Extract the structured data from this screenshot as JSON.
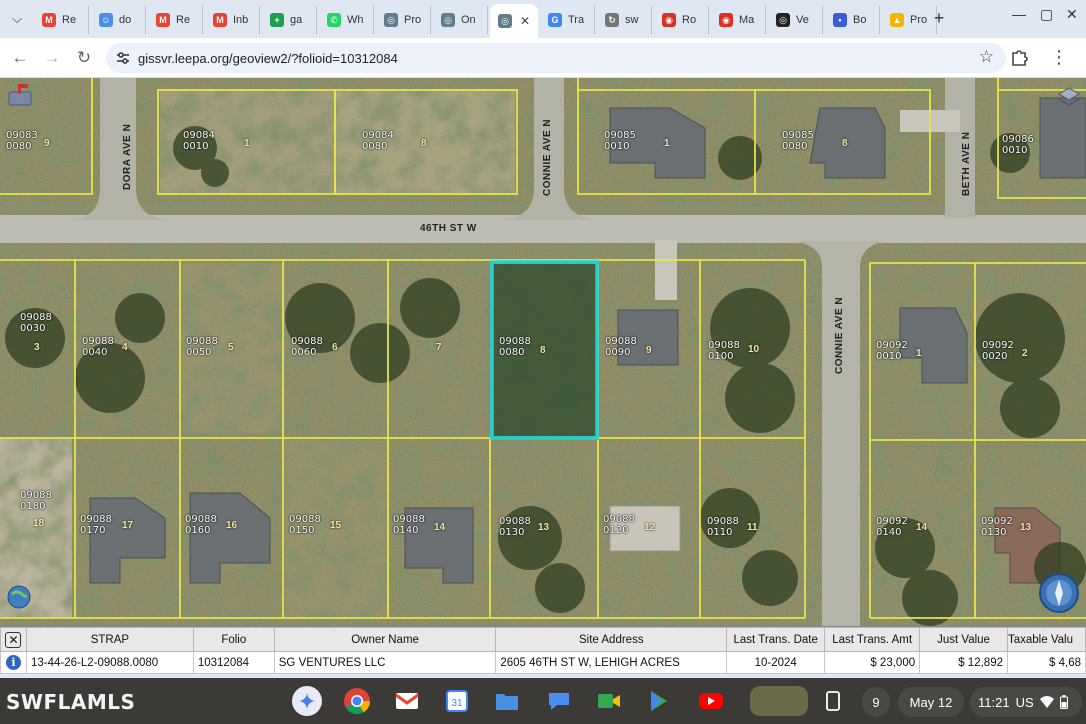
{
  "browser": {
    "tabs": [
      {
        "label": "Re",
        "icon": "gmail-icon"
      },
      {
        "label": "do",
        "icon": "smiley-icon"
      },
      {
        "label": "Re",
        "icon": "gmail-icon"
      },
      {
        "label": "Inb",
        "icon": "gmail-icon"
      },
      {
        "label": "ga",
        "icon": "plus-square-icon"
      },
      {
        "label": "Wh",
        "icon": "whatsapp-icon"
      },
      {
        "label": "Pro",
        "icon": "globe-icon"
      },
      {
        "label": "On",
        "icon": "globe-icon"
      },
      {
        "label": "",
        "icon": "globe-icon",
        "active": true
      },
      {
        "label": "Tra",
        "icon": "translate-icon"
      },
      {
        "label": "sw",
        "icon": "sync-icon"
      },
      {
        "label": "Ro",
        "icon": "target-icon"
      },
      {
        "label": "Ma",
        "icon": "target-icon"
      },
      {
        "label": "Ve",
        "icon": "spiral-icon"
      },
      {
        "label": "Bo",
        "icon": "bird-icon"
      },
      {
        "label": "Pro",
        "icon": "cone-icon"
      }
    ],
    "url": "gissvr.leepa.org/geoview2/?folioid=10312084"
  },
  "map": {
    "streets": {
      "h1": "46TH ST W",
      "v_dora": "DORA AVE N",
      "v_connie_top": "CONNIE AVE N",
      "v_beth": "BETH AVE N",
      "v_connie_right": "CONNIE AVE N"
    },
    "lots_top": [
      {
        "id": "09083\n0080",
        "n": "9"
      },
      {
        "id": "09084\n0010",
        "n": "1"
      },
      {
        "id": "09084\n0080",
        "n": "8"
      },
      {
        "id": "09085\n0010",
        "n": "1"
      },
      {
        "id": "09085\n0080",
        "n": "8"
      },
      {
        "id": "09086\n0010",
        "n": ""
      }
    ],
    "lots_mid": [
      {
        "id": "09088\n0030",
        "n": "3"
      },
      {
        "id": "09088\n0040",
        "n": "4"
      },
      {
        "id": "09088\n0050",
        "n": "5"
      },
      {
        "id": "09088\n0060",
        "n": "6"
      },
      {
        "id": "",
        "n": "7"
      },
      {
        "id": "09088\n0080",
        "n": "8"
      },
      {
        "id": "09088\n0090",
        "n": "9"
      },
      {
        "id": "09088\n0100",
        "n": "10"
      },
      {
        "id": "09092\n0010",
        "n": "1"
      },
      {
        "id": "09092\n0020",
        "n": "2"
      }
    ],
    "lots_bot": [
      {
        "id": "09088\n0180",
        "n": "18"
      },
      {
        "id": "09088\n0170",
        "n": "17"
      },
      {
        "id": "09088\n0160",
        "n": "16"
      },
      {
        "id": "09088\n0150",
        "n": "15"
      },
      {
        "id": "09088\n0140",
        "n": "14"
      },
      {
        "id": "09088\n0130",
        "n": "13"
      },
      {
        "id": "09088\n0120",
        "n": "12"
      },
      {
        "id": "09088\n0110",
        "n": "11"
      },
      {
        "id": "09092\n0140",
        "n": "14"
      },
      {
        "id": "09092\n0130",
        "n": "13"
      }
    ],
    "highlight_color": "#1fd3d3",
    "lot_line_color": "#e9e34a"
  },
  "results": {
    "headers": [
      "STRAP",
      "Folio",
      "Owner Name",
      "Site Address",
      "Last Trans. Date",
      "Last Trans. Amt",
      "Just Value",
      "Taxable Valu"
    ],
    "row": [
      "13-44-26-L2-09088.0080",
      "10312084",
      "SG VENTURES LLC",
      "2605 46TH ST W, LEHIGH ACRES",
      "10-2024",
      "$ 23,000",
      "$ 12,892",
      "$ 4,68"
    ]
  },
  "shelf": {
    "watermark": "SWFLAMLS",
    "date": "May 12",
    "time": "11:21",
    "locale": "US",
    "notifications": "9"
  }
}
